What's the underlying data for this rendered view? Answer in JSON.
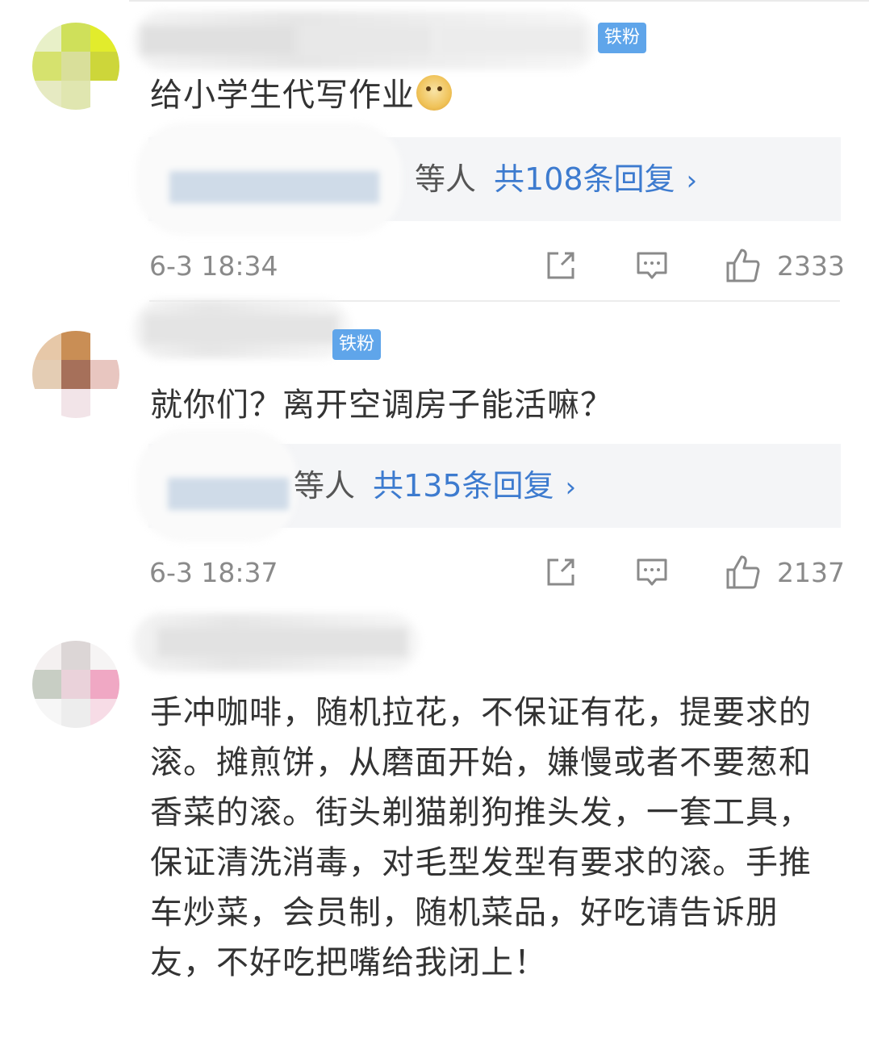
{
  "comments": [
    {
      "badge": "铁粉",
      "text": "给小学生代写作业",
      "emoji": "doge-emoji",
      "reply": {
        "who": "等人",
        "count": "共108条回复"
      },
      "time": "6-3 18:34",
      "likes": "2333"
    },
    {
      "badge": "铁粉",
      "text": "就你们？离开空调房子能活嘛？",
      "reply": {
        "who": "等人",
        "count": "共135条回复"
      },
      "time": "6-3 18:37",
      "likes": "2137"
    },
    {
      "text": "手冲咖啡，随机拉花，不保证有花，提要求的滚。摊煎饼，从磨面开始，嫌慢或者不要葱和香菜的滚。街头剃猫剃狗推头发，一套工具，保证清洗消毒，对毛型发型有要求的滚。手推车炒菜，会员制，随机菜品，好吃请告诉朋友，不好吃把嘴给我闭上！"
    }
  ],
  "icons": {
    "share": "share-icon",
    "comment": "comment-icon",
    "like": "thumbs-up-icon",
    "reply_chevron": "chevron-right-icon"
  },
  "colors": {
    "link_blue": "#3d7bcf",
    "badge_blue": "#5fa5ea",
    "reply_bg": "#f4f5f7",
    "meta_gray": "#8a8a8a"
  }
}
